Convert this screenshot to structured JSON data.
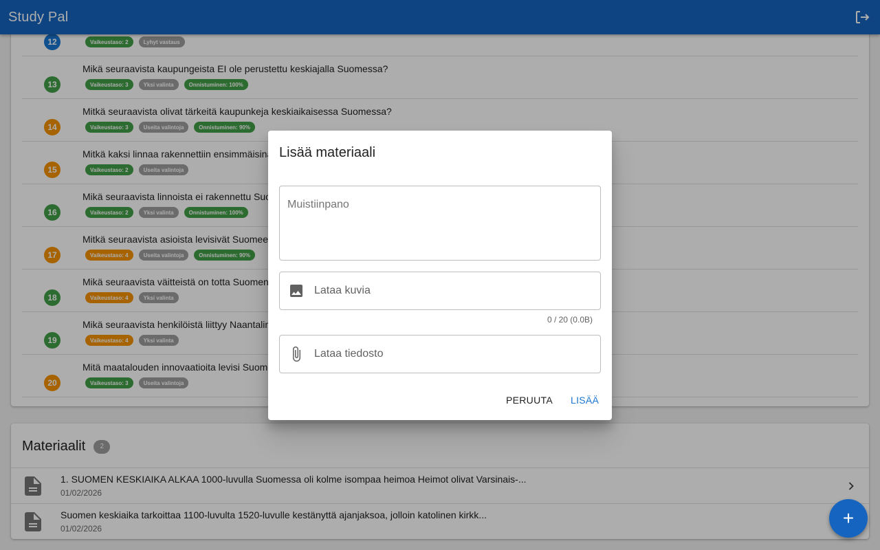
{
  "app": {
    "title": "Study Pal",
    "colors": {
      "primary": "#1565c0",
      "green": "#43a047",
      "orange": "#f59200",
      "grey": "#9e9e9e"
    }
  },
  "questions": [
    {
      "num": "12",
      "text": "",
      "color": "#1976d2",
      "chips": [
        {
          "label": "Vaikeustaso: 2",
          "tone": "green"
        },
        {
          "label": "Lyhyt vastaus",
          "tone": "grey"
        }
      ]
    },
    {
      "num": "13",
      "text": "Mikä seuraavista kaupungeista EI ole perustettu keskiajalla Suomessa?",
      "color": "#43a047",
      "chips": [
        {
          "label": "Vaikeustaso: 3",
          "tone": "green"
        },
        {
          "label": "Yksi valinta",
          "tone": "grey"
        },
        {
          "label": "Onnistuminen: 100%",
          "tone": "green"
        }
      ]
    },
    {
      "num": "14",
      "text": "Mitkä seuraavista olivat tärkeitä kaupunkeja keskiaikaisessa Suomessa?",
      "color": "#f59200",
      "chips": [
        {
          "label": "Vaikeustaso: 3",
          "tone": "green"
        },
        {
          "label": "Useita valintoja",
          "tone": "grey"
        },
        {
          "label": "Onnistuminen: 90%",
          "tone": "green"
        }
      ]
    },
    {
      "num": "15",
      "text": "Mitkä kaksi linnaa rakennettiin ensimmäisinä S",
      "color": "#f59200",
      "chips": [
        {
          "label": "Vaikeustaso: 2",
          "tone": "green"
        },
        {
          "label": "Useita valintoja",
          "tone": "grey"
        }
      ]
    },
    {
      "num": "16",
      "text": "Mikä seuraavista linnoista ei rakennettu Suom",
      "color": "#43a047",
      "chips": [
        {
          "label": "Vaikeustaso: 2",
          "tone": "green"
        },
        {
          "label": "Yksi valinta",
          "tone": "grey"
        },
        {
          "label": "Onnistuminen: 100%",
          "tone": "green"
        }
      ]
    },
    {
      "num": "17",
      "text": "Mitkä seuraavista asioista levisivät Suomeen K",
      "color": "#f59200",
      "chips": [
        {
          "label": "Vaikeustaso: 4",
          "tone": "orange"
        },
        {
          "label": "Useita valintoja",
          "tone": "grey"
        },
        {
          "label": "Onnistuminen: 90%",
          "tone": "green"
        }
      ]
    },
    {
      "num": "18",
      "text": "Mikä seuraavista väitteistä on totta Suomen ke",
      "color": "#43a047",
      "chips": [
        {
          "label": "Vaikeustaso: 4",
          "tone": "orange"
        },
        {
          "label": "Yksi valinta",
          "tone": "grey"
        }
      ]
    },
    {
      "num": "19",
      "text": "Mikä seuraavista henkilöistä liittyy Naantalin lu",
      "color": "#43a047",
      "chips": [
        {
          "label": "Vaikeustaso: 4",
          "tone": "orange"
        },
        {
          "label": "Yksi valinta",
          "tone": "grey"
        }
      ]
    },
    {
      "num": "20",
      "text": "Mitä maatalouden innovaatioita levisi Suomee",
      "color": "#f59200",
      "chips": [
        {
          "label": "Vaikeustaso: 3",
          "tone": "green"
        },
        {
          "label": "Useita valintoja",
          "tone": "grey"
        }
      ]
    }
  ],
  "materials": {
    "title": "Materiaalit",
    "count": "2",
    "items": [
      {
        "text": "1. SUOMEN KESKIAIKA ALKAA 1000-luvulla Suomessa oli kolme isompaa heimoa Heimot olivat Varsinais-...",
        "date": "01/02/2026"
      },
      {
        "text": "Suomen keskiaika tarkoittaa 1100-luvulta 1520-luvulle kestänyttä ajanjaksoa, jolloin katolinen kirkk...",
        "date": "01/02/2026"
      }
    ]
  },
  "dialog": {
    "title": "Lisää materiaali",
    "note_placeholder": "Muistiinpano",
    "upload_images_label": "Lataa kuvia",
    "image_counter": "0 / 20 (0.0B)",
    "upload_file_label": "Lataa tiedosto",
    "cancel_label": "PERUUTA",
    "add_label": "LISÄÄ"
  },
  "fab": {
    "icon": "plus-icon",
    "label": "+"
  }
}
